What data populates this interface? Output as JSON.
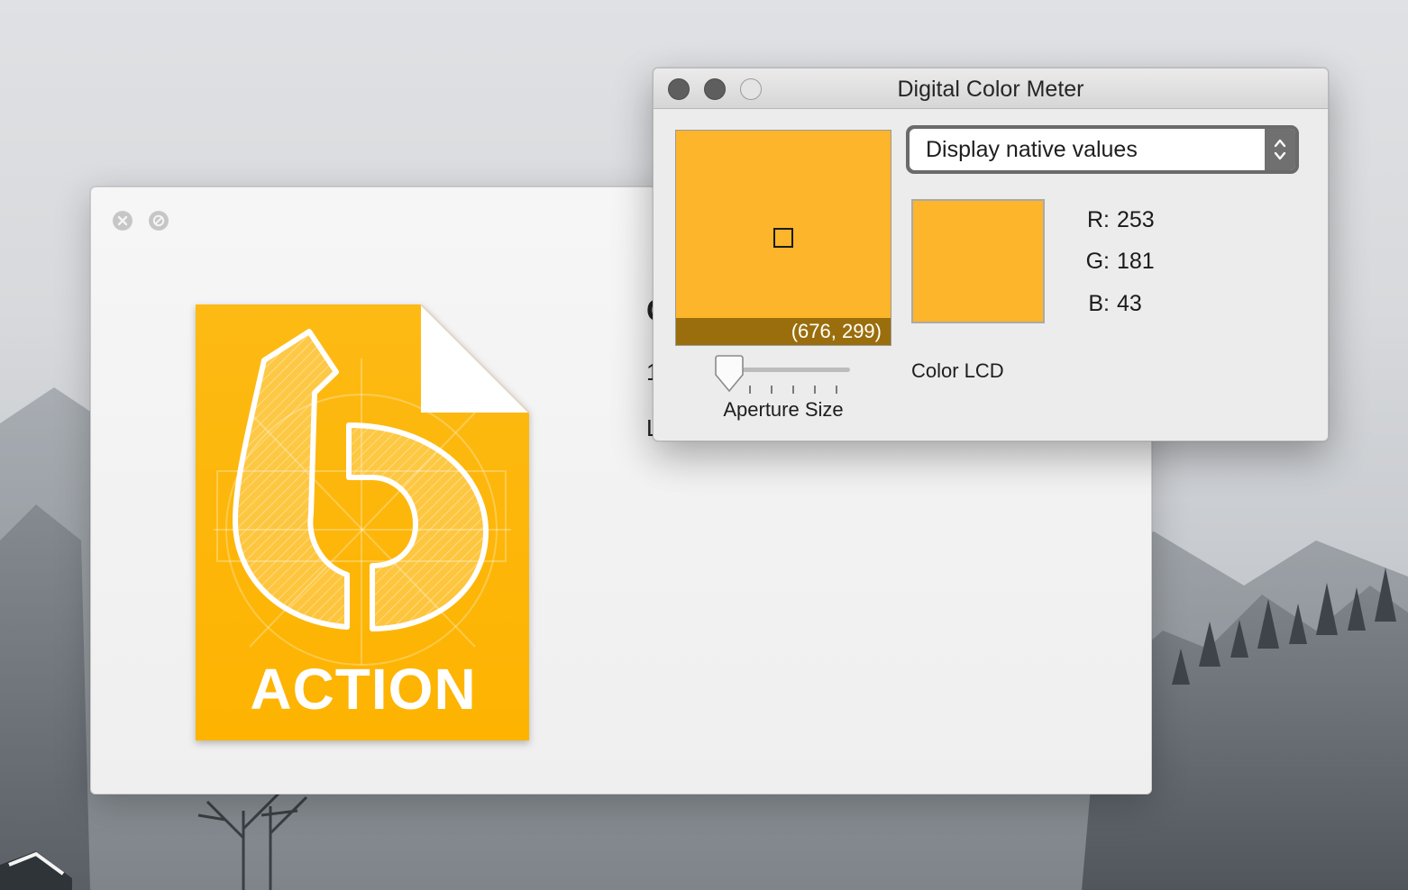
{
  "quicklook": {
    "close_icon": "close-x-icon",
    "fullscreen_icon": "fullscreen-icon",
    "file_icon_label": "ACTION",
    "hidden_title_fragment": "C",
    "hidden_line_fragment_1": "1",
    "hidden_line_fragment_2": "L"
  },
  "color_meter": {
    "title": "Digital Color Meter",
    "display_mode": "Display native values",
    "coordinates": "(676, 299)",
    "aperture_label": "Aperture Size",
    "aperture_level": 0,
    "color_profile": "Color LCD",
    "red_label": "R:",
    "red_value": "253",
    "green_label": "G:",
    "green_value": "181",
    "blue_label": "B:",
    "blue_value": "43",
    "sampled_color": "#fdb52b"
  },
  "colors": {
    "accent": "#fdb52b",
    "coords_bar": "#9a6e0c"
  }
}
